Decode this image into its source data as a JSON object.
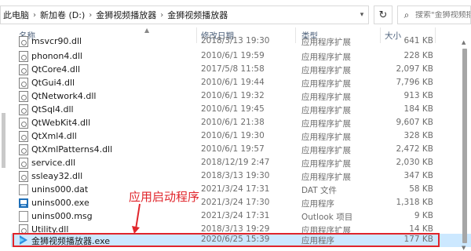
{
  "address_bar": {
    "crumbs": [
      "此电脑",
      "新加卷 (D:)",
      "金狮视频播放器",
      "金狮视频播放器"
    ],
    "search_placeholder": "搜索\"金狮视频播放器\""
  },
  "columns": {
    "name": "名称",
    "date": "修改日期",
    "type": "类型",
    "size": "大小"
  },
  "files": [
    {
      "name": "msvcr90.dll",
      "date": "2018/3/13 19:30",
      "type": "应用程序扩展",
      "size": "641 KB",
      "icon": "dll-file-icon"
    },
    {
      "name": "phonon4.dll",
      "date": "2010/6/1 19:59",
      "type": "应用程序扩展",
      "size": "228 KB",
      "icon": "dll-file-icon"
    },
    {
      "name": "QtCore4.dll",
      "date": "2017/5/8 11:58",
      "type": "应用程序扩展",
      "size": "2,097 KB",
      "icon": "dll-file-icon"
    },
    {
      "name": "QtGui4.dll",
      "date": "2010/6/1 19:44",
      "type": "应用程序扩展",
      "size": "7,796 KB",
      "icon": "dll-file-icon"
    },
    {
      "name": "QtNetwork4.dll",
      "date": "2010/6/1 19:32",
      "type": "应用程序扩展",
      "size": "913 KB",
      "icon": "dll-file-icon"
    },
    {
      "name": "QtSql4.dll",
      "date": "2010/6/1 19:45",
      "type": "应用程序扩展",
      "size": "184 KB",
      "icon": "dll-file-icon"
    },
    {
      "name": "QtWebKit4.dll",
      "date": "2010/6/1 21:38",
      "type": "应用程序扩展",
      "size": "9,607 KB",
      "icon": "dll-file-icon"
    },
    {
      "name": "QtXml4.dll",
      "date": "2010/6/1 19:30",
      "type": "应用程序扩展",
      "size": "328 KB",
      "icon": "dll-file-icon"
    },
    {
      "name": "QtXmlPatterns4.dll",
      "date": "2010/6/1 19:57",
      "type": "应用程序扩展",
      "size": "2,472 KB",
      "icon": "dll-file-icon"
    },
    {
      "name": "service.dll",
      "date": "2018/12/19 2:47",
      "type": "应用程序扩展",
      "size": "2,030 KB",
      "icon": "dll-file-icon"
    },
    {
      "name": "ssleay32.dll",
      "date": "2018/3/13 19:30",
      "type": "应用程序扩展",
      "size": "347 KB",
      "icon": "dll-file-icon"
    },
    {
      "name": "unins000.dat",
      "date": "2021/3/24 17:31",
      "type": "DAT 文件",
      "size": "58 KB",
      "icon": "dat-file-icon"
    },
    {
      "name": "unins000.exe",
      "date": "2021/3/24 17:30",
      "type": "应用程序",
      "size": "1,318 KB",
      "icon": "installer-exe-icon"
    },
    {
      "name": "unins000.msg",
      "date": "2021/3/24 17:31",
      "type": "Outlook 项目",
      "size": "9 KB",
      "icon": "msg-file-icon"
    },
    {
      "name": "Utility.dll",
      "date": "2018/3/13 19:29",
      "type": "应用程序扩展",
      "size": "14 KB",
      "icon": "dll-file-icon"
    },
    {
      "name": "金狮视频播放器.exe",
      "date": "2020/6/25 15:39",
      "type": "应用程序",
      "size": "177 KB",
      "icon": "player-exe-icon"
    }
  ],
  "annotation": {
    "text": "应用启动程序",
    "color": "#e0252b"
  },
  "colors": {
    "selection": "#cce8ff",
    "header_text": "#4c607a",
    "highlight_box": "#e0252b"
  }
}
